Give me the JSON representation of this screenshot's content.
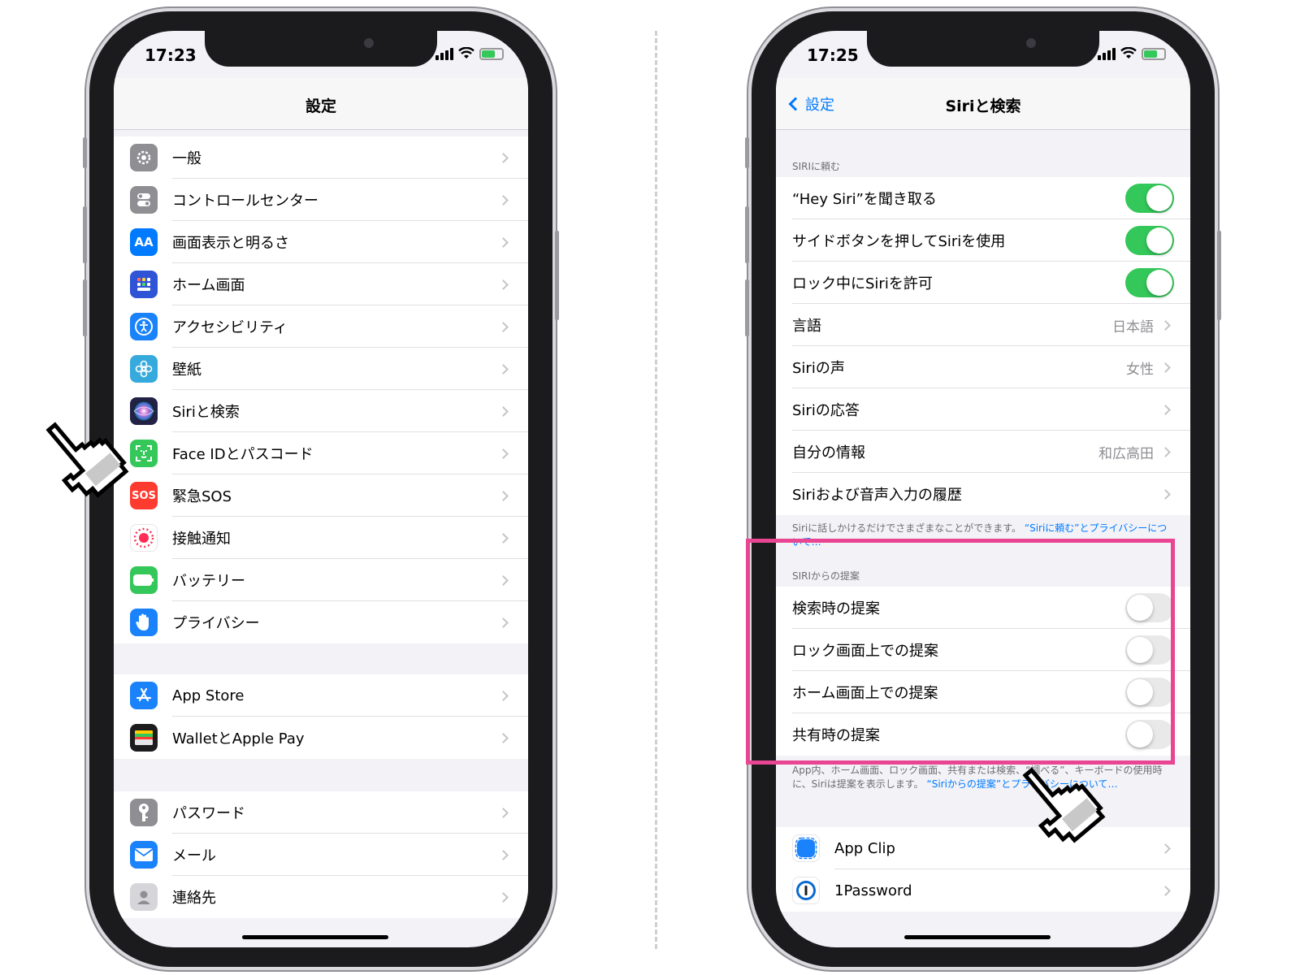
{
  "left_phone": {
    "status_time": "17:23",
    "nav_title": "設定",
    "group1": [
      {
        "label": "一般",
        "icon": "gear-icon",
        "color": "#8e8e93"
      },
      {
        "label": "コントロールセンター",
        "icon": "switches-icon",
        "color": "#8e8e93"
      },
      {
        "label": "画面表示と明るさ",
        "icon": "text-size-icon",
        "color": "#007aff",
        "glyph": "AA"
      },
      {
        "label": "ホーム画面",
        "icon": "home-grid-icon",
        "color": "#2f54d6"
      },
      {
        "label": "アクセシビリティ",
        "icon": "accessibility-icon",
        "color": "#1a82fb"
      },
      {
        "label": "壁紙",
        "icon": "flower-icon",
        "color": "#36aadc"
      },
      {
        "label": "Siriと検索",
        "icon": "siri-icon",
        "color": "#222246"
      },
      {
        "label": "Face IDとパスコード",
        "icon": "face-id-icon",
        "color": "#34c759"
      },
      {
        "label": "緊急SOS",
        "icon": "sos-icon",
        "color": "#ff3b30",
        "glyph": "SOS"
      },
      {
        "label": "接触通知",
        "icon": "exposure-icon",
        "color": "#ffffff"
      },
      {
        "label": "バッテリー",
        "icon": "battery-icon",
        "color": "#34c759"
      },
      {
        "label": "プライバシー",
        "icon": "hand-icon",
        "color": "#1a82fb"
      }
    ],
    "group2": [
      {
        "label": "App Store",
        "icon": "app-store-icon",
        "color": "#1a82fb"
      },
      {
        "label": "WalletとApple Pay",
        "icon": "wallet-icon",
        "color": "#1c1c1e"
      }
    ],
    "group3": [
      {
        "label": "パスワード",
        "icon": "key-icon",
        "color": "#8e8e93"
      },
      {
        "label": "メール",
        "icon": "mail-icon",
        "color": "#1a82fb"
      },
      {
        "label": "連絡先",
        "icon": "contacts-icon",
        "color": "#c7c7cc"
      }
    ]
  },
  "right_phone": {
    "status_time": "17:25",
    "back_label": "設定",
    "nav_title": "Siriと検索",
    "ask_siri_header": "SIRIに頼む",
    "ask_siri_rows": [
      {
        "label": "“Hey Siri”を聞き取る",
        "toggle": "on"
      },
      {
        "label": "サイドボタンを押してSiriを使用",
        "toggle": "on"
      },
      {
        "label": "ロック中にSiriを許可",
        "toggle": "on"
      },
      {
        "label": "言語",
        "value": "日本語"
      },
      {
        "label": "Siriの声",
        "value": "女性"
      },
      {
        "label": "Siriの応答",
        "value": ""
      },
      {
        "label": "自分の情報",
        "value": "和広高田"
      },
      {
        "label": "Siriおよび音声入力の履歴",
        "value": ""
      }
    ],
    "ask_siri_footer_text": "Siriに話しかけるだけでさまざまなことができます。",
    "ask_siri_footer_link": "“Siriに頼む”とプライバシーについて…",
    "suggestions_header": "SIRIからの提案",
    "suggestion_rows": [
      {
        "label": "検索時の提案",
        "toggle": "off"
      },
      {
        "label": "ロック画面上での提案",
        "toggle": "off"
      },
      {
        "label": "ホーム画面上での提案",
        "toggle": "off"
      },
      {
        "label": "共有時の提案",
        "toggle": "off"
      }
    ],
    "suggestions_footer_text": "App内、ホーム画面、ロック画面、共有または検索、“調べる”、キーボードの使用時に、Siriは提案を表示します。",
    "suggestions_footer_link": "“Siriからの提案”とプライバシーについて…",
    "apps": [
      {
        "label": "App Clip",
        "icon": "app-clip-icon",
        "color": "#1a82fb"
      },
      {
        "label": "1Password",
        "icon": "onepassword-icon",
        "color": "#ffffff"
      }
    ]
  },
  "accent_colors": {
    "highlight": "#e94592",
    "toggle_on": "#34c759",
    "link": "#007aff"
  }
}
